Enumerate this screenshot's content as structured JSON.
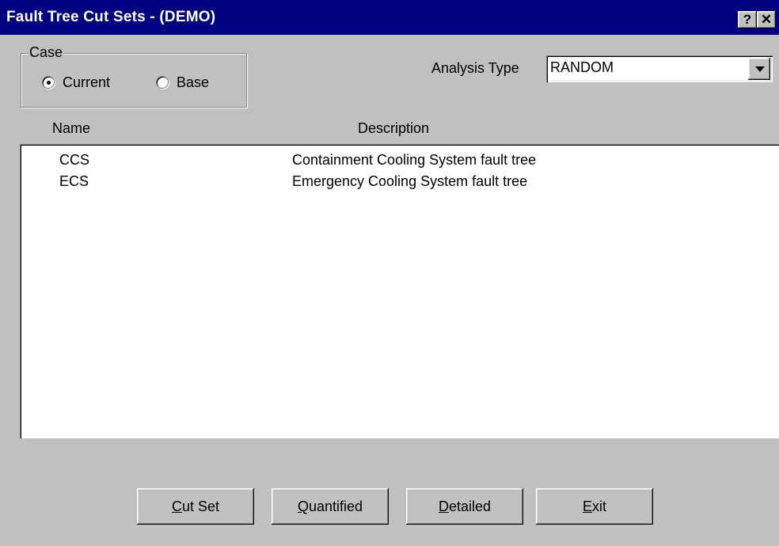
{
  "window": {
    "title": "Fault Tree Cut Sets  -  (DEMO)",
    "help_label": "?",
    "close_label": "✕"
  },
  "case": {
    "legend": "Case",
    "options": [
      {
        "label": "Current",
        "selected": true
      },
      {
        "label": "Base",
        "selected": false
      }
    ]
  },
  "analysis": {
    "label": "Analysis Type",
    "value": "RANDOM"
  },
  "table": {
    "columns": [
      "Name",
      "Description"
    ],
    "rows": [
      {
        "name": "CCS",
        "description": "Containment Cooling System fault tree"
      },
      {
        "name": "ECS",
        "description": "Emergency Cooling System fault tree"
      }
    ]
  },
  "buttons": {
    "cut_set": {
      "mnemonic": "C",
      "rest": "ut Set"
    },
    "quantified": {
      "mnemonic": "Q",
      "rest": "uantified"
    },
    "detailed": {
      "mnemonic": "D",
      "rest": "etailed"
    },
    "exit": {
      "mnemonic": "E",
      "rest": "xit"
    }
  }
}
